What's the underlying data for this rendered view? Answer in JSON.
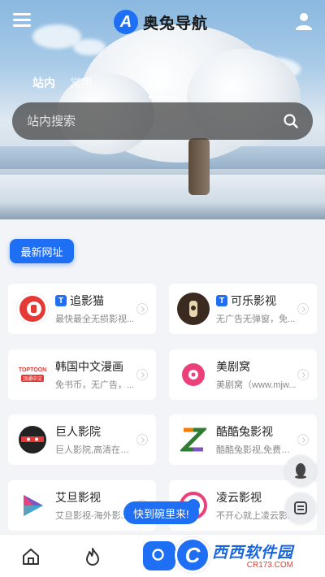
{
  "app": {
    "name": "奥兔导航",
    "logo_letter": "A"
  },
  "header": {
    "menu_icon": "menu-icon",
    "user_icon": "user-icon"
  },
  "tabs": [
    {
      "label": "站内",
      "active": true
    },
    {
      "label": "常用",
      "active": false
    }
  ],
  "search": {
    "placeholder": "站内搜索",
    "icon": "search-icon"
  },
  "section": {
    "label": "最新网址"
  },
  "sites": [
    {
      "title": "追影猫",
      "badge": "T",
      "desc": "最快最全无损影视...",
      "icon": "zhuiyingmao-icon",
      "color": "#e53935"
    },
    {
      "title": "可乐影视",
      "badge": "T",
      "desc": "无广告无弹窗，免...",
      "icon": "kele-icon",
      "color": "#3b2a20"
    },
    {
      "title": "韩国中文漫画",
      "badge": "",
      "desc": "免书币，无广告，...",
      "icon": "toptoon-icon",
      "color": "#e53935",
      "icon_text": "TOPTOON",
      "icon_subtext": "顶通中文"
    },
    {
      "title": "美剧窝",
      "badge": "",
      "desc": "美剧窝（www.mjw...",
      "icon": "meijuwo-icon",
      "color": "#ec407a"
    },
    {
      "title": "巨人影院",
      "badge": "",
      "desc": "巨人影院,高清在线...",
      "icon": "juren-icon",
      "color": "#222222"
    },
    {
      "title": "酷酷兔影视",
      "badge": "",
      "desc": "酷酷兔影视,免费提...",
      "icon": "kukutu-icon",
      "color": "#2e7d32"
    },
    {
      "title": "艾旦影视",
      "badge": "",
      "desc": "艾旦影视-海外影...",
      "icon": "aidan-icon",
      "color": "#7e57c2"
    },
    {
      "title": "凌云影视",
      "badge": "",
      "desc": "不开心就上凌云影...",
      "icon": "lingyun-icon",
      "color": "#1f6ff5"
    }
  ],
  "floating": [
    {
      "icon": "qq-icon"
    },
    {
      "icon": "calculator-icon"
    }
  ],
  "toast": {
    "label": "快到碗里来!"
  },
  "bottom_nav": [
    {
      "icon": "home-icon"
    },
    {
      "icon": "fire-icon"
    },
    {
      "icon": "search-icon"
    }
  ],
  "watermark": {
    "title": "西西软件园",
    "url": "CR173.COM",
    "letter": "C"
  },
  "colors": {
    "accent": "#1f6ff5",
    "background": "#f2f4f7"
  }
}
